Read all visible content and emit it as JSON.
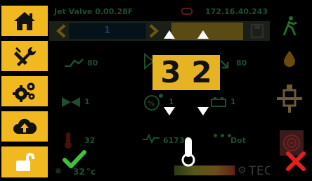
{
  "header": {
    "valve_name": "Jet Valve 0.00.28F",
    "ip_address": "172.16.40.243"
  },
  "program": {
    "number": "1"
  },
  "readings": {
    "pulse_value": "80",
    "valve_value": "80",
    "open_value": "1",
    "percent_value": "1",
    "battery_value": "1",
    "temp_value": "32",
    "cycles_value": "6173",
    "dot_label": "Dot",
    "ambient_temp": "32",
    "ambient_unit": "°c"
  },
  "editor": {
    "digit_1": "3",
    "digit_2": "2"
  },
  "brand": {
    "name": "TECHCON"
  },
  "colors": {
    "accent": "#f2b820",
    "confirm": "#3ec23a",
    "cancel": "#e02020",
    "dim_green": "#1f4d2e"
  }
}
